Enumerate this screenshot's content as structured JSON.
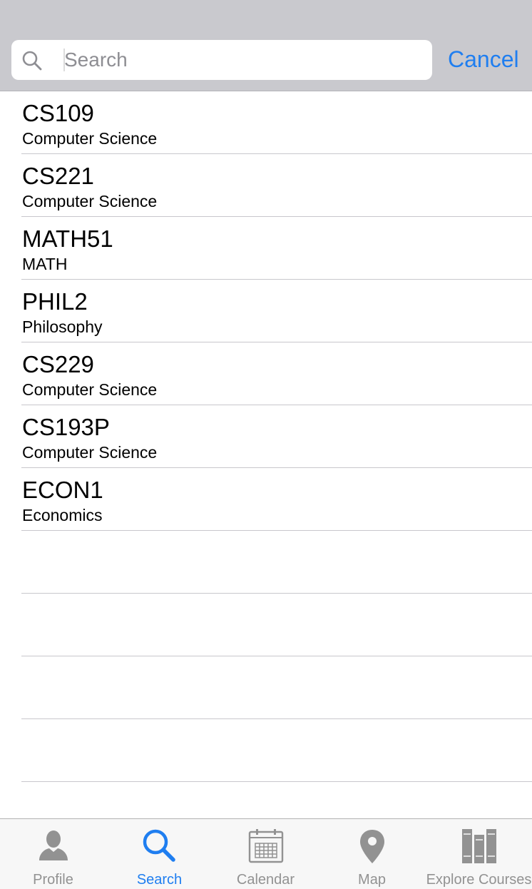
{
  "search": {
    "placeholder": "Search",
    "value": "",
    "cancel_label": "Cancel"
  },
  "results": [
    {
      "code": "CS109",
      "department": "Computer Science"
    },
    {
      "code": "CS221",
      "department": "Computer Science"
    },
    {
      "code": "MATH51",
      "department": "MATH"
    },
    {
      "code": "PHIL2",
      "department": "Philosophy"
    },
    {
      "code": "CS229",
      "department": "Computer Science"
    },
    {
      "code": "CS193P",
      "department": "Computer Science"
    },
    {
      "code": "ECON1",
      "department": "Economics"
    }
  ],
  "tabs": [
    {
      "label": "Profile",
      "icon": "person-icon",
      "active": false
    },
    {
      "label": "Search",
      "icon": "search-icon",
      "active": true
    },
    {
      "label": "Calendar",
      "icon": "calendar-icon",
      "active": false
    },
    {
      "label": "Map",
      "icon": "map-pin-icon",
      "active": false
    },
    {
      "label": "Explore Courses",
      "icon": "books-icon",
      "active": false
    }
  ],
  "colors": {
    "accent": "#1f7ef0",
    "header_bg": "#c9c9ce",
    "inactive_tab": "#929292",
    "separator": "#c8c7cc"
  }
}
